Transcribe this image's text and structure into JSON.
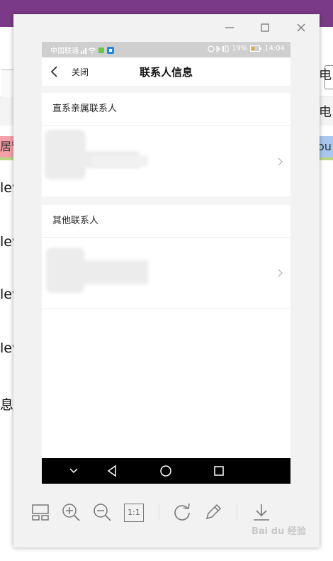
{
  "background_app": {
    "left_tab_text": "居管",
    "right_tab_text": "ou",
    "right_texts": [
      "电",
      "电"
    ],
    "left_texts": [
      "lev",
      "lev",
      "lev",
      "lev",
      "息"
    ]
  },
  "viewer": {
    "window_controls": [
      "minimize",
      "maximize",
      "close"
    ]
  },
  "phone": {
    "status_left": "中国联通",
    "battery": "19%",
    "time": "14:04",
    "close_label": "关闭",
    "title": "联系人信息",
    "sections": [
      {
        "header": "直系亲属联系人"
      },
      {
        "header": "其他联系人"
      }
    ]
  },
  "toolbar": {
    "actual_size_label": "1:1",
    "tools": [
      "thumbnail-view",
      "zoom-in",
      "zoom-out",
      "actual-size",
      "rotate",
      "edit",
      "download"
    ]
  },
  "watermark": "Bai du 经验"
}
